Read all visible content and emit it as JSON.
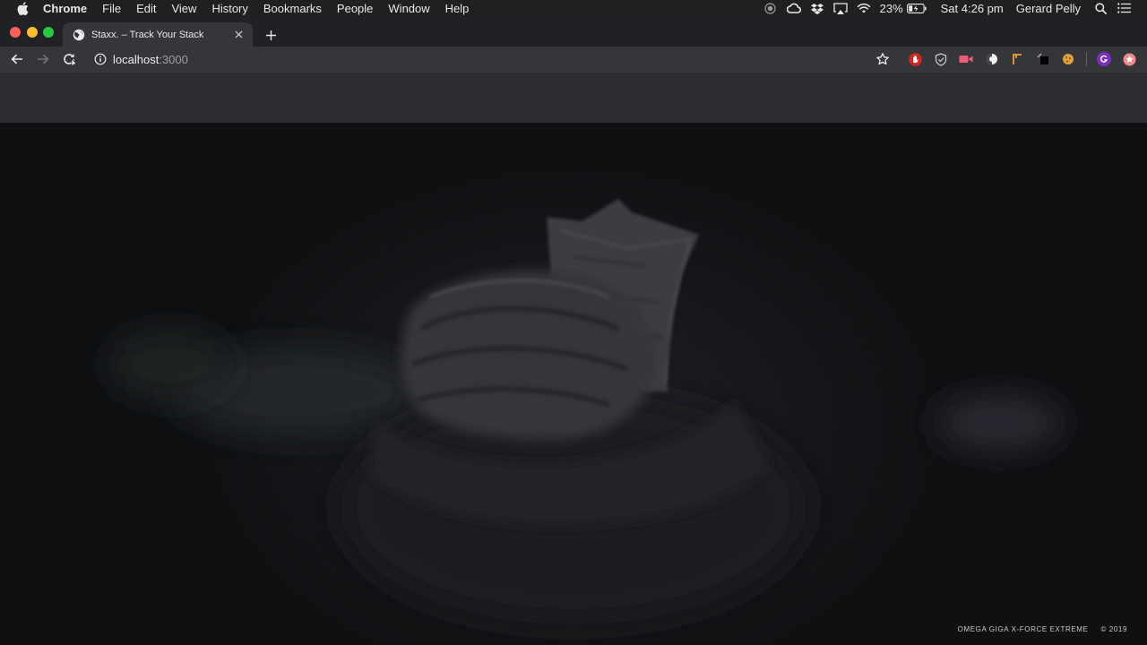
{
  "menubar": {
    "app_name": "Chrome",
    "items": [
      "File",
      "Edit",
      "View",
      "History",
      "Bookmarks",
      "People",
      "Window",
      "Help"
    ],
    "battery": "23%",
    "clock": "Sat 4:26 pm",
    "user": "Gerard Pelly"
  },
  "browser": {
    "tab_title": "Staxx. – Track Your Stack",
    "url_host": "localhost",
    "url_port": ":3000"
  },
  "page": {
    "footer_brand": "OMEGA GIGA X-FORCE EXTREME",
    "footer_copyright": "© 2019"
  },
  "icons": {
    "apple": "apple-icon",
    "record": "record-icon",
    "creative_cloud": "creative-cloud-icon",
    "dropbox": "dropbox-icon",
    "airplay": "airplay-icon",
    "wifi": "wifi-icon",
    "battery": "battery-icon",
    "search": "search-icon",
    "list": "list-icon",
    "globe": "globe-icon",
    "back": "back-arrow-icon",
    "forward": "forward-arrow-icon",
    "reload": "reload-icon",
    "info": "info-icon",
    "star": "star-icon"
  },
  "colors": {
    "traffic_close": "#fe5f57",
    "traffic_min": "#febc2e",
    "traffic_max": "#28c840",
    "avatar": "#7b2fbe"
  }
}
